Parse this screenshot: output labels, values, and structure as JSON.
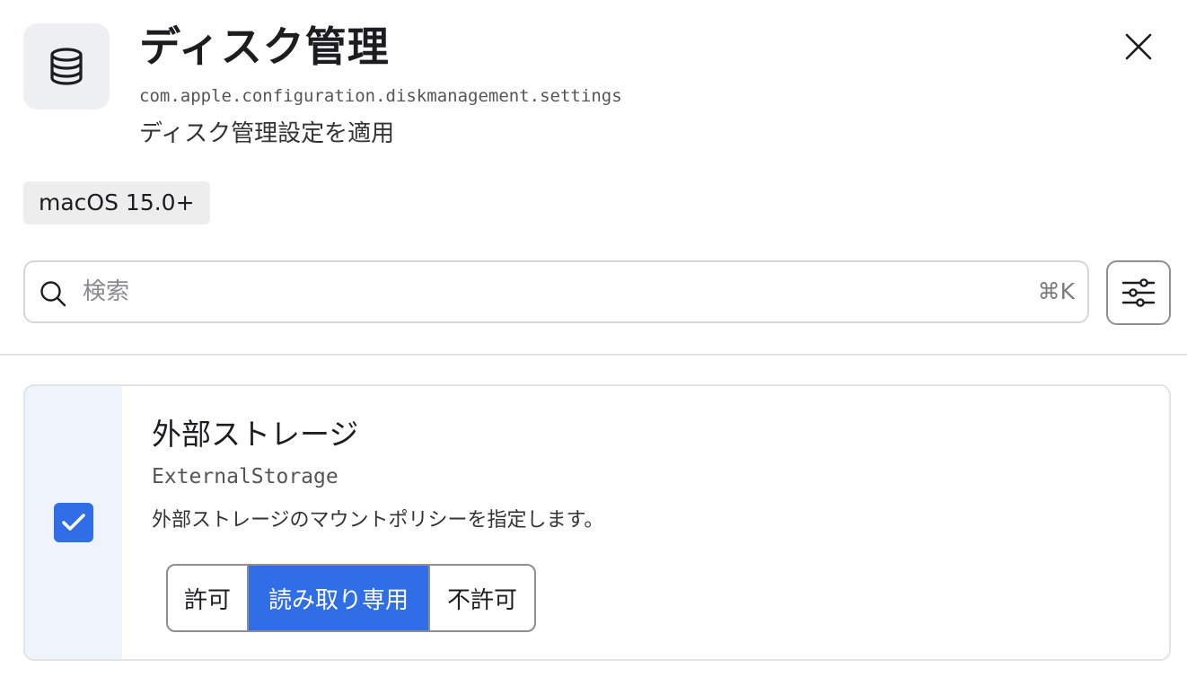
{
  "header": {
    "icon": "database-icon",
    "title": "ディスク管理",
    "identifier": "com.apple.configuration.diskmanagement.settings",
    "subtitle": "ディスク管理設定を適用",
    "close_icon": "close-icon"
  },
  "badge": {
    "label": "macOS 15.0+"
  },
  "search": {
    "icon": "search-icon",
    "placeholder": "検索",
    "value": "",
    "shortcut": "⌘K"
  },
  "filter": {
    "icon": "sliders-icon"
  },
  "settings": [
    {
      "enabled": true,
      "title": "外部ストレージ",
      "key": "ExternalStorage",
      "description": "外部ストレージのマウントポリシーを指定します。",
      "options": [
        "許可",
        "読み取り専用",
        "不許可"
      ],
      "selected": "読み取り専用"
    }
  ],
  "colors": {
    "accent": "#2f6ee6",
    "gutter": "#eff3fc",
    "icon_tile": "#eeeff2",
    "border": "#e3e3e6"
  }
}
